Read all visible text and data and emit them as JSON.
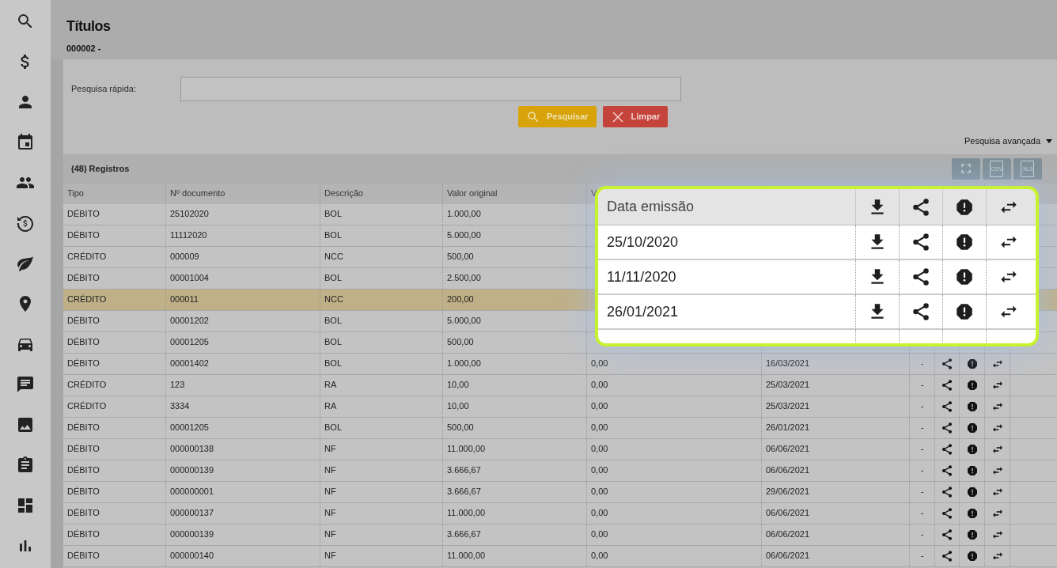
{
  "sidebar": {
    "items": [
      {
        "kind": "search"
      },
      {
        "kind": "dollar"
      },
      {
        "kind": "person"
      },
      {
        "kind": "calendar"
      },
      {
        "kind": "group"
      },
      {
        "kind": "money-cycle"
      },
      {
        "kind": "leaf"
      },
      {
        "kind": "pin"
      },
      {
        "kind": "car"
      },
      {
        "kind": "chat"
      },
      {
        "kind": "image"
      },
      {
        "kind": "clipboard"
      },
      {
        "kind": "dashboard"
      },
      {
        "kind": "chart"
      }
    ]
  },
  "page": {
    "title": "Títulos",
    "subtitle": "000002 -"
  },
  "search": {
    "label": "Pesquisa rápida:",
    "buttons": [
      {
        "kind": "search",
        "label": "Pesquisar"
      },
      {
        "kind": "clear",
        "label": "Limpar"
      }
    ],
    "advanced": "Pesquisa avançada"
  },
  "table": {
    "title": "(48) Registros",
    "toolbar": [
      {
        "kind": "fullscreen"
      },
      {
        "kind": "file",
        "label": "CSV"
      },
      {
        "kind": "file",
        "label": "XLS"
      }
    ],
    "columns": [
      "Tipo",
      "Nº documento",
      "Descrição",
      "Valor original",
      "V"
    ],
    "action_columns": [
      {
        "kind": "share"
      },
      {
        "kind": "alert"
      },
      {
        "kind": "swap"
      }
    ],
    "rows": [
      {
        "cells": [
          "DÉBITO",
          "25102020",
          "BOL",
          "1.000,00"
        ],
        "selected": false
      },
      {
        "cells": [
          "DÉBITO",
          "11112020",
          "BOL",
          "5.000,00"
        ],
        "selected": false
      },
      {
        "cells": [
          "CRÉDITO",
          "000009",
          "NCC",
          "500,00"
        ],
        "selected": false
      },
      {
        "cells": [
          "DÉBITO",
          "00001004",
          "BOL",
          "2.500,00"
        ],
        "selected": false
      },
      {
        "cells": [
          "CRÉDITO",
          "000011",
          "NCC",
          "200,00"
        ],
        "selected": true
      },
      {
        "cells": [
          "DÉBITO",
          "00001202",
          "BOL",
          "5.000,00"
        ],
        "selected": false
      },
      {
        "cells": [
          "DÉBITO",
          "00001205",
          "BOL",
          "500,00"
        ],
        "selected": false
      },
      {
        "cells": [
          "DÉBITO",
          "00001402",
          "BOL",
          "1.000,00",
          "0,00",
          "16/03/2021",
          "-"
        ],
        "actions": true,
        "selected": false
      },
      {
        "cells": [
          "CRÉDITO",
          "123",
          "RA",
          "10,00",
          "0,00",
          "25/03/2021",
          "-"
        ],
        "actions": true,
        "selected": false
      },
      {
        "cells": [
          "CRÉDITO",
          "3334",
          "RA",
          "10,00",
          "0,00",
          "25/03/2021",
          "-"
        ],
        "actions": true,
        "selected": false
      },
      {
        "cells": [
          "DÉBITO",
          "00001205",
          "BOL",
          "500,00",
          "0,00",
          "26/01/2021",
          "-"
        ],
        "actions": true,
        "selected": false
      },
      {
        "cells": [
          "DÉBITO",
          "000000138",
          "NF",
          "11.000,00",
          "0,00",
          "06/06/2021",
          "-"
        ],
        "actions": true,
        "selected": false
      },
      {
        "cells": [
          "DÉBITO",
          "000000139",
          "NF",
          "3.666,67",
          "0,00",
          "06/06/2021",
          "-"
        ],
        "actions": true,
        "selected": false
      },
      {
        "cells": [
          "DÉBITO",
          "000000001",
          "NF",
          "3.666,67",
          "0,00",
          "29/06/2021",
          "-"
        ],
        "actions": true,
        "selected": false
      },
      {
        "cells": [
          "DÉBITO",
          "000000137",
          "NF",
          "11.000,00",
          "0,00",
          "06/06/2021",
          "-"
        ],
        "actions": true,
        "selected": false
      },
      {
        "cells": [
          "DÉBITO",
          "000000139",
          "NF",
          "3.666,67",
          "0,00",
          "06/06/2021",
          "-"
        ],
        "actions": true,
        "selected": false
      },
      {
        "cells": [
          "DÉBITO",
          "000000140",
          "NF",
          "11.000,00",
          "0,00",
          "06/06/2021",
          "-"
        ],
        "actions": true,
        "selected": false
      }
    ]
  },
  "callout": {
    "column": "Data emissão",
    "actions": [
      {
        "kind": "download"
      },
      {
        "kind": "share"
      },
      {
        "kind": "alert"
      },
      {
        "kind": "swap"
      }
    ],
    "rows": [
      "25/10/2020",
      "11/11/2020",
      "26/01/2021"
    ]
  }
}
